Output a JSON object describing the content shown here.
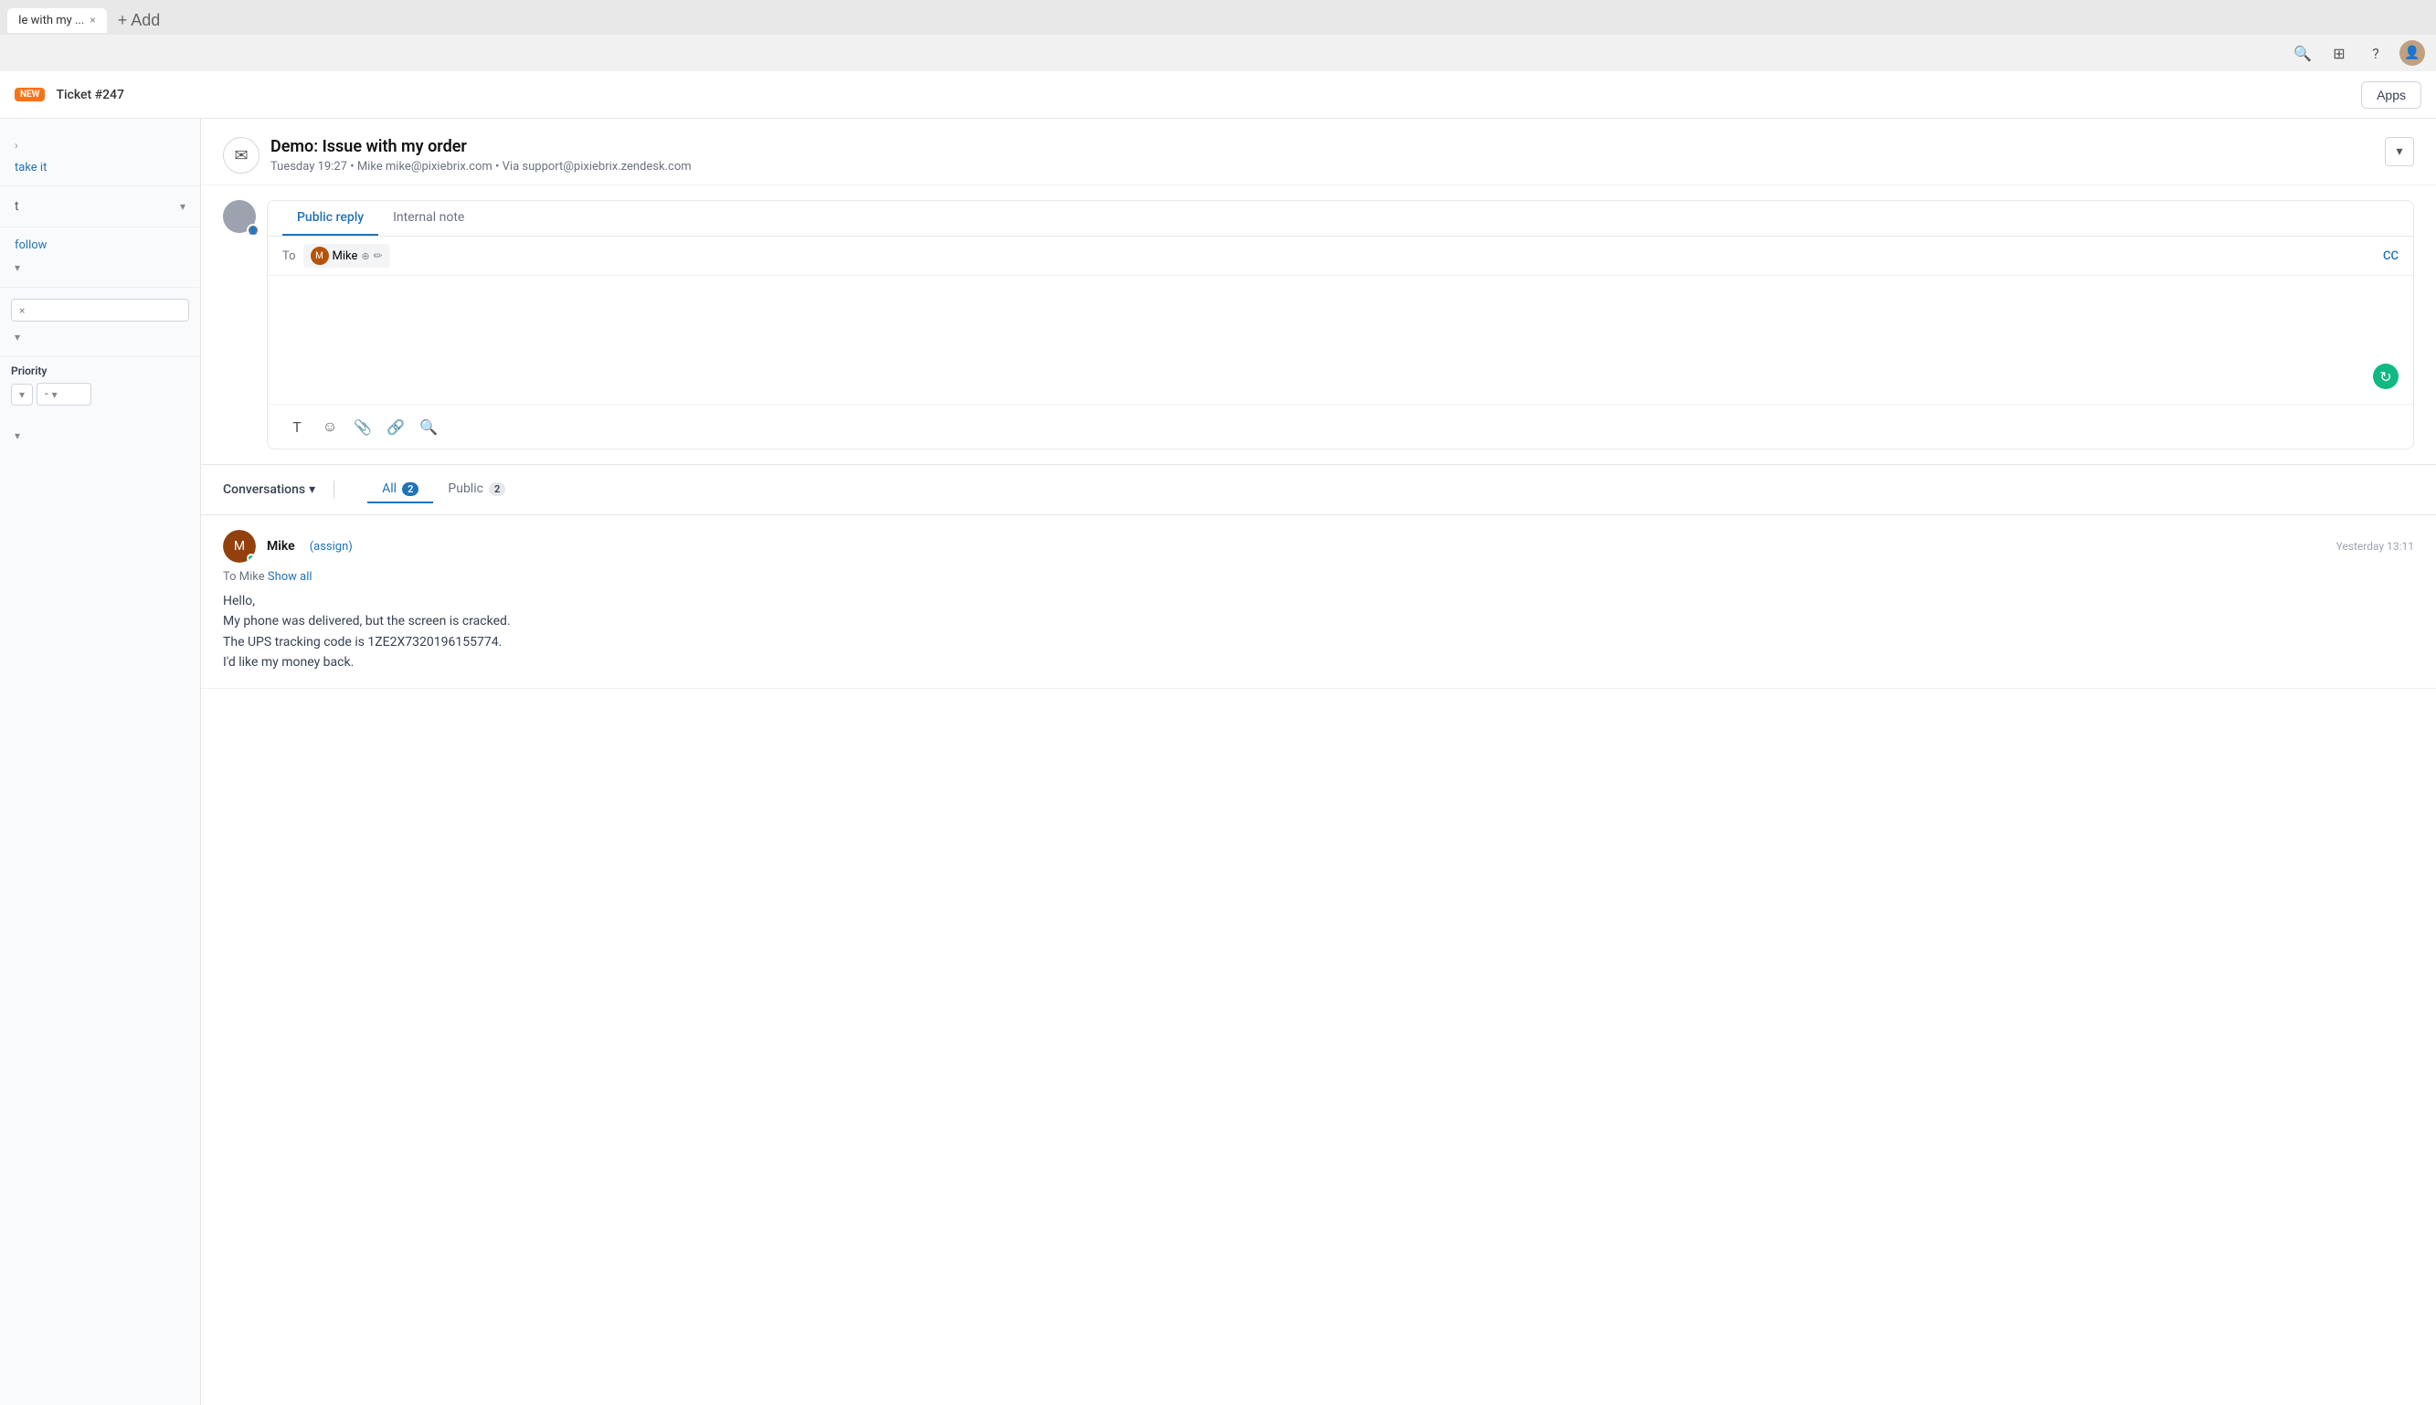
{
  "browser": {
    "tab_title": "Ie with my ...",
    "tab_close": "×",
    "add_tab": "+ Add",
    "icons": {
      "search": "🔍",
      "grid": "⊞",
      "help": "?",
      "profile": "👤"
    }
  },
  "header": {
    "new_badge": "NEW",
    "ticket_label": "Ticket #247",
    "apps_button": "Apps"
  },
  "sidebar": {
    "action_take": "take it",
    "action_follow": "follow",
    "priority_label": "Priority",
    "priority_type": "-",
    "chevron": "›"
  },
  "email": {
    "subject": "Demo: Issue with my order",
    "meta": "Tuesday 19:27  •  Mike   mike@pixiebrix.com  •  Via support@pixiebrix.zendesk.com",
    "icon": "✉"
  },
  "reply": {
    "tab_public": "Public reply",
    "tab_internal": "Internal note",
    "to_label": "To",
    "recipient": "Mike",
    "cc_label": "CC",
    "refresh_icon": "↻",
    "toolbar": {
      "text": "T",
      "emoji": "☺",
      "attach": "📎",
      "link": "🔗",
      "search": "🔍"
    }
  },
  "conversations": {
    "title": "Conversations",
    "chevron": "▾",
    "filter_all": "All",
    "filter_all_count": "2",
    "filter_public": "Public",
    "filter_public_count": "2"
  },
  "message": {
    "sender": "Mike",
    "assign_link": "(assign)",
    "to_text": "To Mike",
    "show_all": "Show all",
    "time": "Yesterday 13:11",
    "body_line1": "Hello,",
    "body_line2": "My phone was delivered, but the screen is cracked.",
    "body_line3": "The UPS tracking code is 1ZE2X7320196155774.",
    "body_line4": "I'd like my money back."
  }
}
